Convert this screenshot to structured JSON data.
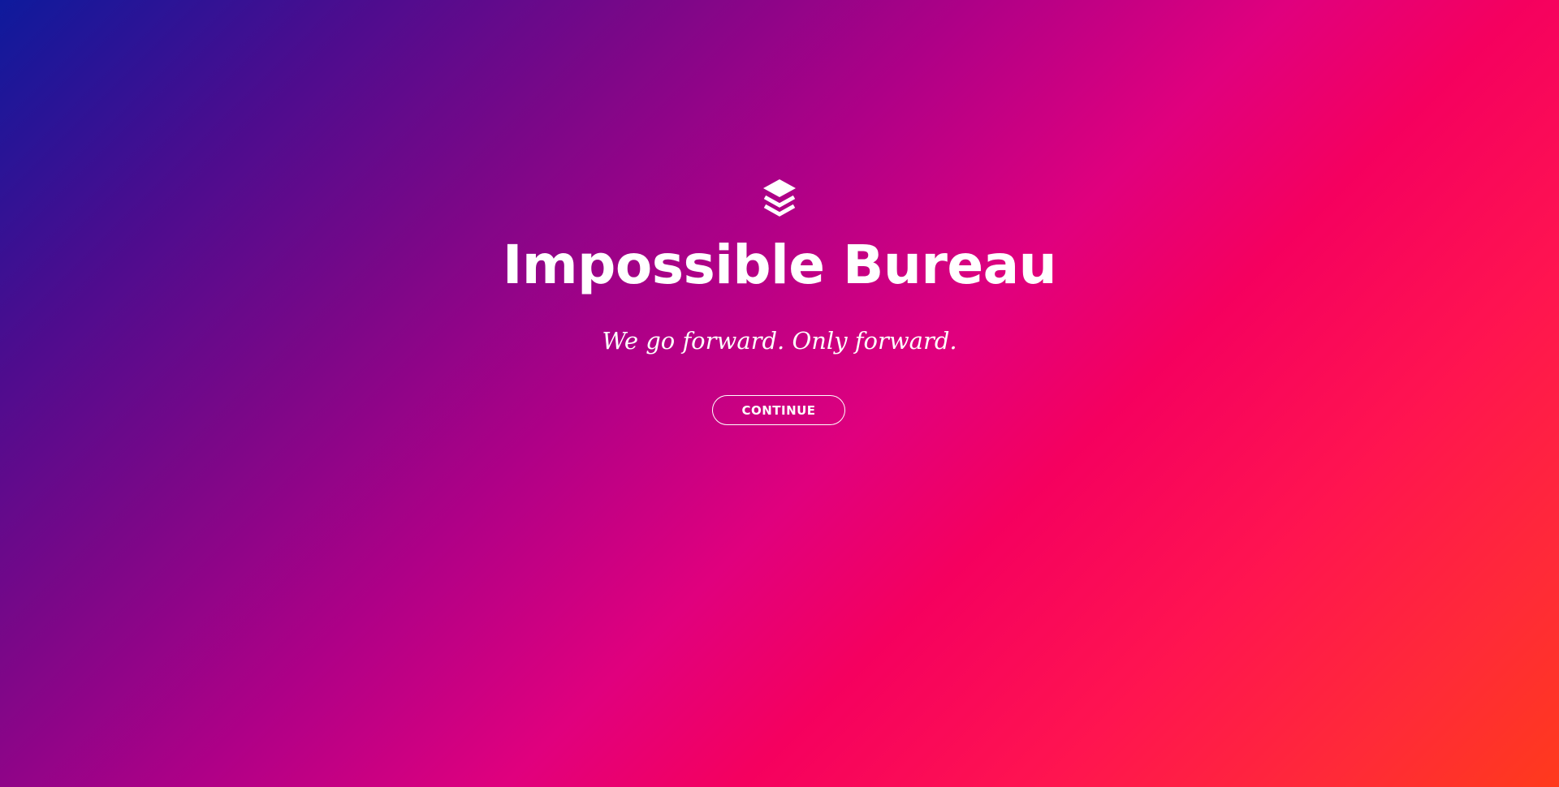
{
  "hero": {
    "logo_icon": "stacked-layers-icon",
    "title": "Impossible Bureau",
    "tagline": "We go forward. Only forward.",
    "continue_label": "CONTINUE"
  },
  "colors": {
    "gradient_start": "#0e1a9c",
    "gradient_mid": "#e0007e",
    "gradient_end": "#ff3a1c",
    "text": "#ffffff"
  }
}
